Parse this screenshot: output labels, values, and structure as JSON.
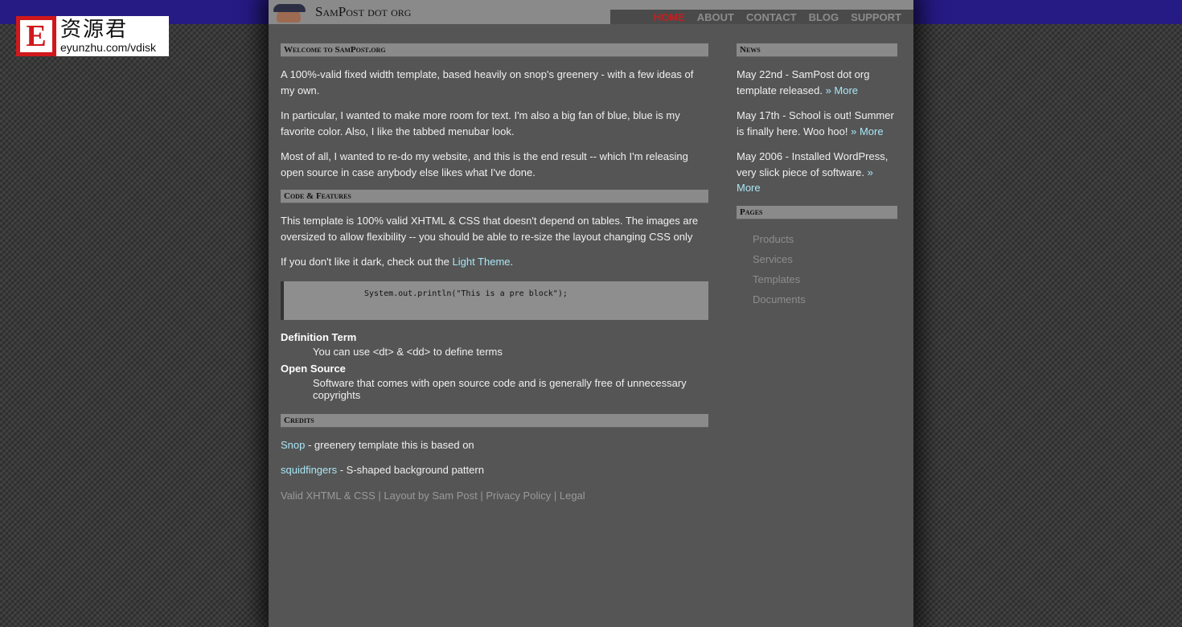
{
  "badge": {
    "letter": "E",
    "chinese": "资源君",
    "url": "eyunzhu.com/vdisk"
  },
  "header": {
    "site_title": "SamPost dot org"
  },
  "nav": {
    "items": [
      "HOME",
      "ABOUT",
      "CONTACT",
      "BLOG",
      "SUPPORT"
    ],
    "active": "HOME"
  },
  "welcome": {
    "heading": "Welcome to SamPost.org",
    "p1": "A 100%-valid fixed width template, based heavily on snop's greenery - with a few ideas of my own.",
    "p2": "In particular, I wanted to make more room for text. I'm also a big fan of blue, blue is my favorite color. Also, I like the tabbed menubar look.",
    "p3": "Most of all, I wanted to re-do my website, and this is the end result -- which I'm releasing open source in case anybody else likes what I've done."
  },
  "code": {
    "heading": "Code & Features",
    "p1": "This template is 100% valid XHTML & CSS that doesn't depend on tables. The images are oversized to allow flexibility -- you should be able to re-size the layout changing CSS only",
    "p2_prefix": "If you don't like it dark, check out the ",
    "p2_link": "Light Theme",
    "p2_suffix": ".",
    "pre": "System.out.println(\"This is a pre block\");",
    "dt1": "Definition Term",
    "dd1": "You can use <dt> & <dd> to define terms",
    "dt2": "Open Source",
    "dd2": "Software that comes with open source code and is generally free of unnecessary copyrights"
  },
  "credits": {
    "heading": "Credits",
    "c1_link": "Snop",
    "c1_text": " - greenery template this is based on",
    "c2_link": "squidfingers",
    "c2_text": " - S-shaped background pattern"
  },
  "footer": {
    "l1": "Valid XHTML & CSS",
    "l2": "Layout by Sam Post",
    "l3": "Privacy Policy",
    "l4": "Legal",
    "sep": " | "
  },
  "news": {
    "heading": "News",
    "items": [
      {
        "text": "May 22nd - SamPost dot org template released. ",
        "more": "» More"
      },
      {
        "text": "May 17th - School is out! Summer is finally here. Woo hoo! ",
        "more": "» More"
      },
      {
        "text": "May 2006 - Installed WordPress, very slick piece of software. ",
        "more": "» More"
      }
    ]
  },
  "pages": {
    "heading": "Pages",
    "items": [
      "Products",
      "Services",
      "Templates",
      "Documents"
    ]
  },
  "colors": {
    "band": "#261a84",
    "link": "#a8e6f5",
    "active_nav": "#c21f1f",
    "panel": "#555555"
  }
}
